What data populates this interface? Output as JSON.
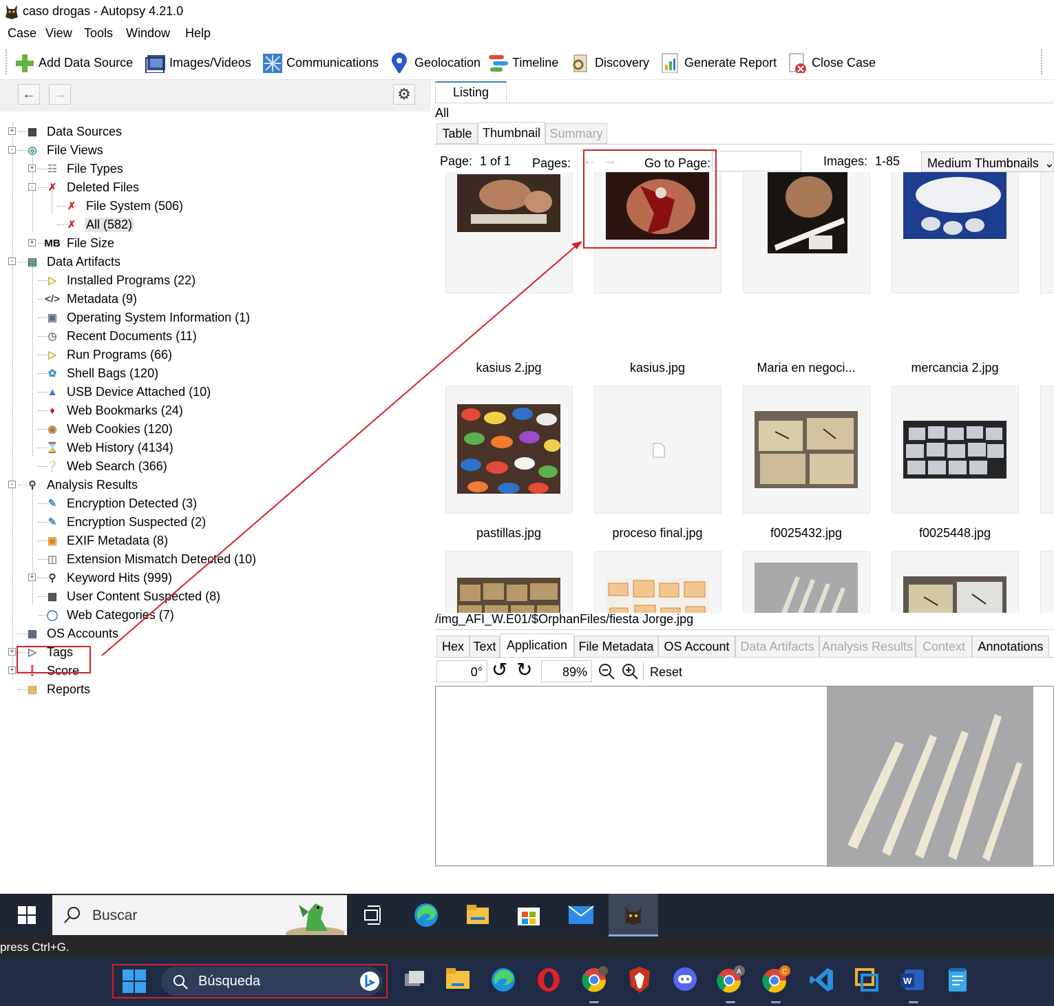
{
  "window": {
    "title": "caso drogas - Autopsy 4.21.0"
  },
  "menu": [
    "Case",
    "View",
    "Tools",
    "Window",
    "Help"
  ],
  "toolbar": [
    {
      "label": "Add Data Source",
      "icon": "plus-icon"
    },
    {
      "label": "Images/Videos",
      "icon": "images-icon"
    },
    {
      "label": "Communications",
      "icon": "communications-icon"
    },
    {
      "label": "Geolocation",
      "icon": "map-pin-icon"
    },
    {
      "label": "Timeline",
      "icon": "timeline-icon"
    },
    {
      "label": "Discovery",
      "icon": "discovery-icon"
    },
    {
      "label": "Generate Report",
      "icon": "report-icon"
    },
    {
      "label": "Close Case",
      "icon": "close-case-icon"
    }
  ],
  "tree": [
    {
      "label": "Data Sources",
      "icon": "disk-icon"
    },
    {
      "label": "File Views",
      "icon": "eye-icon"
    },
    {
      "label": "File Types",
      "icon": "file-types-icon"
    },
    {
      "label": "Deleted Files",
      "icon": "deleted-file-icon"
    },
    {
      "label": "File System (506)",
      "icon": "deleted-file-icon"
    },
    {
      "label": "All (582)",
      "icon": "deleted-file-icon"
    },
    {
      "label": "File Size",
      "icon": "mb-icon"
    },
    {
      "label": "Data Artifacts",
      "icon": "artifacts-icon"
    },
    {
      "label": "Installed Programs (22)",
      "icon": "programs-icon"
    },
    {
      "label": "Metadata (9)",
      "icon": "code-icon"
    },
    {
      "label": "Operating System Information (1)",
      "icon": "computer-icon"
    },
    {
      "label": "Recent Documents (11)",
      "icon": "recent-doc-icon"
    },
    {
      "label": "Run Programs (66)",
      "icon": "programs-icon"
    },
    {
      "label": "Shell Bags (120)",
      "icon": "shell-bags-icon"
    },
    {
      "label": "USB Device Attached (10)",
      "icon": "usb-icon"
    },
    {
      "label": "Web Bookmarks (24)",
      "icon": "bookmark-icon"
    },
    {
      "label": "Web Cookies (120)",
      "icon": "cookie-icon"
    },
    {
      "label": "Web History (4134)",
      "icon": "hourglass-icon"
    },
    {
      "label": "Web Search (366)",
      "icon": "web-search-icon"
    },
    {
      "label": "Analysis Results",
      "icon": "magnifier-icon"
    },
    {
      "label": "Encryption Detected (3)",
      "icon": "encryption-icon"
    },
    {
      "label": "Encryption Suspected (2)",
      "icon": "encryption-icon"
    },
    {
      "label": "EXIF Metadata (8)",
      "icon": "camera-icon"
    },
    {
      "label": "Extension Mismatch Detected (10)",
      "icon": "mismatch-icon"
    },
    {
      "label": "Keyword Hits (999)",
      "icon": "magnifier-icon"
    },
    {
      "label": "User Content Suspected (8)",
      "icon": "user-content-icon"
    },
    {
      "label": "Web Categories (7)",
      "icon": "globe-icon"
    },
    {
      "label": "OS Accounts",
      "icon": "accounts-icon"
    },
    {
      "label": "Tags",
      "icon": "tag-icon"
    },
    {
      "label": "Score",
      "icon": "score-icon"
    },
    {
      "label": "Reports",
      "icon": "reports-icon"
    }
  ],
  "listing": {
    "tab": "Listing",
    "filter": "All",
    "view_tabs": [
      "Table",
      "Thumbnail",
      "Summary"
    ],
    "page_label": "Page:",
    "page_value": "1 of 1",
    "pages_label": "Pages:",
    "goto_label": "Go to Page:",
    "images_label": "Images:",
    "images_value": "1-85",
    "size_select": "Medium Thumbnails",
    "thumbnails": [
      "kasius 2.jpg",
      "kasius.jpg",
      "Maria en negoci...",
      "mercancia 2.jpg",
      "pastillas.jpg",
      "proceso final.jpg",
      "f0025432.jpg",
      "f0025448.jpg"
    ],
    "path": "/img_AFI_W.E01/$OrphanFiles/fiesta Jorge.jpg"
  },
  "content_tabs": [
    "Hex",
    "Text",
    "Application",
    "File Metadata",
    "OS Account",
    "Data Artifacts",
    "Analysis Results",
    "Context",
    "Annotations"
  ],
  "viewer": {
    "rotation": "0°",
    "zoom": "89%",
    "reset": "Reset"
  },
  "win10_taskbar": {
    "search": "Buscar"
  },
  "status": "press Ctrl+G.",
  "win11_taskbar": {
    "search": "Búsqueda"
  },
  "colors": {
    "annotation_red": "#d0222c",
    "win11_bar": "#1f2b44",
    "win10_bar": "#1f2633"
  }
}
